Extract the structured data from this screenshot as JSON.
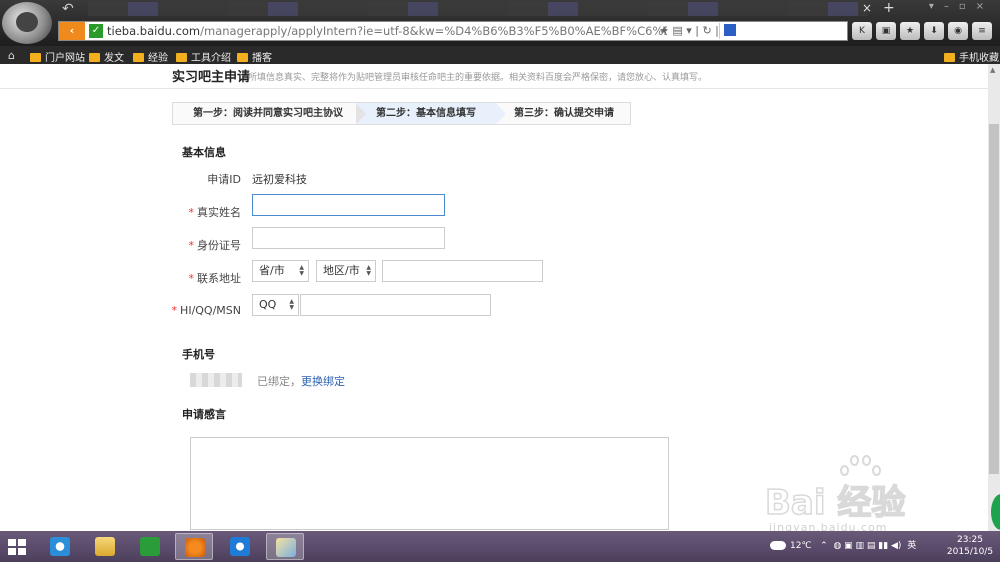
{
  "browser": {
    "url_host": "tieba.baidu.com",
    "url_path": "/managerapply/applyIntern?ie=utf-8&kw=%D4%B6%B3%F5%B0%AE%BF%C6%BC%BC",
    "bookmarks": [
      "门户网站",
      "发文",
      "经验",
      "工具介绍",
      "播客"
    ],
    "bookmark_right": "手机收藏"
  },
  "page": {
    "title": "实习吧主申请",
    "hint": "所填信息真实、完整将作为贴吧管理员审核任命吧主的重要依据。相关资料百度会严格保密，请您放心、认真填写。",
    "steps": [
      "第一步：阅读并同意实习吧主协议",
      "第二步：基本信息填写",
      "第三步：确认提交申请"
    ],
    "basic_info_title": "基本信息",
    "apply_id_label": "申请ID",
    "apply_id_value": "远初爱科技",
    "real_name_label": "真实姓名",
    "id_number_label": "身份证号",
    "address_label": "联系地址",
    "province_select": "省/市",
    "district_select": "地区/市",
    "im_label": "HI/QQ/MSN",
    "im_select": "QQ",
    "required_mark": "*",
    "phone_title": "手机号",
    "phone_bound": "已绑定，",
    "phone_change": "更换绑定",
    "statement_title": "申请感言"
  },
  "watermark": {
    "text": "Bai 经验",
    "url": "jingyan.baidu.com"
  },
  "taskbar": {
    "temperature": "12℃",
    "ime": "英",
    "time": "23:25",
    "date": "2015/10/5"
  },
  "colors": {
    "accent_orange": "#f08a1c",
    "link_blue": "#2d64b3",
    "required_red": "#e33333",
    "active_step_bg": "#e8f0fb"
  }
}
